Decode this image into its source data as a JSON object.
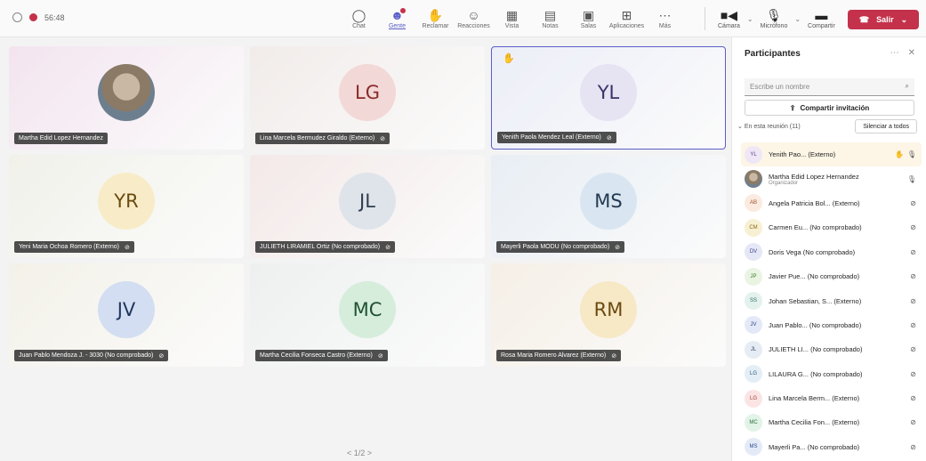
{
  "topbar": {
    "timer": "56:48",
    "tools": [
      {
        "label": "Chat",
        "icon": "chat-icon",
        "glyph": "◯"
      },
      {
        "label": "Gente",
        "icon": "people-icon",
        "glyph": "☻",
        "active": true,
        "badge": true
      },
      {
        "label": "Reclamar",
        "icon": "raise-hand-icon",
        "glyph": "✋"
      },
      {
        "label": "Reacciones",
        "icon": "reactions-icon",
        "glyph": "☺"
      },
      {
        "label": "Vista",
        "icon": "view-icon",
        "glyph": "▦"
      },
      {
        "label": "Notas",
        "icon": "notes-icon",
        "glyph": "▤"
      },
      {
        "label": "Salas",
        "icon": "rooms-icon",
        "glyph": "▣"
      },
      {
        "label": "Aplicaciones",
        "icon": "apps-icon",
        "glyph": "⊞"
      },
      {
        "label": "Más",
        "icon": "more-icon",
        "glyph": "⋯"
      }
    ],
    "camera": "Cámara",
    "mic": "Micrófono",
    "share": "Compartir",
    "leave": "Salir"
  },
  "tiles": [
    {
      "name": "Martha Edid Lopez Hernandez",
      "initials": "",
      "photo": true,
      "bg": "#f3e4ef",
      "circle": "",
      "fg": ""
    },
    {
      "name": "Lina Marcela Bermudez Giraldo (Externo)",
      "initials": "LG",
      "bg": "#f1ecea",
      "circle": "#f2d8d6",
      "fg": "#8a2a2a"
    },
    {
      "name": "Yenith Paola Mendez Leal (Externo)",
      "initials": "YL",
      "bg": "#eceef8",
      "circle": "#e6e3f3",
      "fg": "#3a3266",
      "selected": true,
      "hand": "✋"
    },
    {
      "name": "Yeni Maria Ochoa Romero (Externo)",
      "initials": "YR",
      "bg": "#f1f1ea",
      "circle": "#f8ecc8",
      "fg": "#6b4a10"
    },
    {
      "name": "JULIETH LIRAMIEL Ortiz (No comprobado)",
      "initials": "JL",
      "bg": "#f3e9e8",
      "circle": "#dfe4ea",
      "fg": "#2f3d4d"
    },
    {
      "name": "Mayerli Paola MODU (No comprobado)",
      "initials": "MS",
      "bg": "#e8eef4",
      "circle": "#d9e6f1",
      "fg": "#243a52"
    },
    {
      "name": "Juan Pablo Mendoza J. - 3030 (No comprobado)",
      "initials": "JV",
      "bg": "#f3f1e8",
      "circle": "#d3def2",
      "fg": "#22375e"
    },
    {
      "name": "Martha Cecilia Fonseca Castro (Externo)",
      "initials": "MC",
      "bg": "#eef0f0",
      "circle": "#d6eddc",
      "fg": "#1f5132"
    },
    {
      "name": "Rosa Maria Romero Alvarez (Externo)",
      "initials": "RM",
      "bg": "#f5efe6",
      "circle": "#f7e8c6",
      "fg": "#6b4a10"
    }
  ],
  "pager": "< 1/2 >",
  "sidebar": {
    "title": "Participantes",
    "search_placeholder": "Escribe un nombre",
    "share_invite": "Compartir invitación",
    "in_meeting": "En esta reunión (11)",
    "admit_all": "Silenciar a todos",
    "people": [
      {
        "initials": "YL",
        "name": "Yenith Pao... (Externo)",
        "bg": "#efe7f6",
        "fg": "#5b3a8a",
        "hl": true,
        "hand": "✋",
        "mic": "🎙"
      },
      {
        "initials": "",
        "name": "Martha Edid Lopez Hernandez",
        "sub": "Organizador",
        "photo": true,
        "mic": "🎙"
      },
      {
        "initials": "AB",
        "name": "Angela Patricia Bol... (Externo)",
        "bg": "#fbeadf",
        "fg": "#a0522d",
        "mic": "⊘"
      },
      {
        "initials": "CM",
        "name": "Carmen Eu... (No comprobado)",
        "bg": "#f7f0d3",
        "fg": "#8a6d10",
        "mic": "⊘"
      },
      {
        "initials": "DV",
        "name": "Doris Vega (No comprobado)",
        "bg": "#e6e7f6",
        "fg": "#3a3f8a",
        "mic": "⊘"
      },
      {
        "initials": "JP",
        "name": "Javier Pue... (No comprobado)",
        "bg": "#eaf4e3",
        "fg": "#3d7a2a",
        "mic": "⊘"
      },
      {
        "initials": "SS",
        "name": "Johan Sebastian, S... (Externo)",
        "bg": "#e3f2ee",
        "fg": "#2a6b5a",
        "mic": "⊘"
      },
      {
        "initials": "JV",
        "name": "Juan Pablo... (No comprobado)",
        "bg": "#e4e9f7",
        "fg": "#2a3f8a",
        "mic": "⊘"
      },
      {
        "initials": "JL",
        "name": "JULIETH LI... (No comprobado)",
        "bg": "#e6ecf3",
        "fg": "#34506b",
        "mic": "⊘"
      },
      {
        "initials": "LG",
        "name": "LILAURA G... (No comprobado)",
        "bg": "#e3eef6",
        "fg": "#2a5a7a",
        "mic": "⊘"
      },
      {
        "initials": "LG",
        "name": "Lina Marcela Berm... (Externo)",
        "bg": "#fbe4e4",
        "fg": "#a03a3a",
        "mic": "⊘"
      },
      {
        "initials": "MC",
        "name": "Martha Cecilia Fon... (Externo)",
        "bg": "#e2f3e7",
        "fg": "#2a6b3d",
        "mic": "⊘"
      },
      {
        "initials": "MS",
        "name": "Mayerli Pa... (No comprobado)",
        "bg": "#e4ebf7",
        "fg": "#2a4a8a",
        "mic": "⊘"
      }
    ]
  }
}
